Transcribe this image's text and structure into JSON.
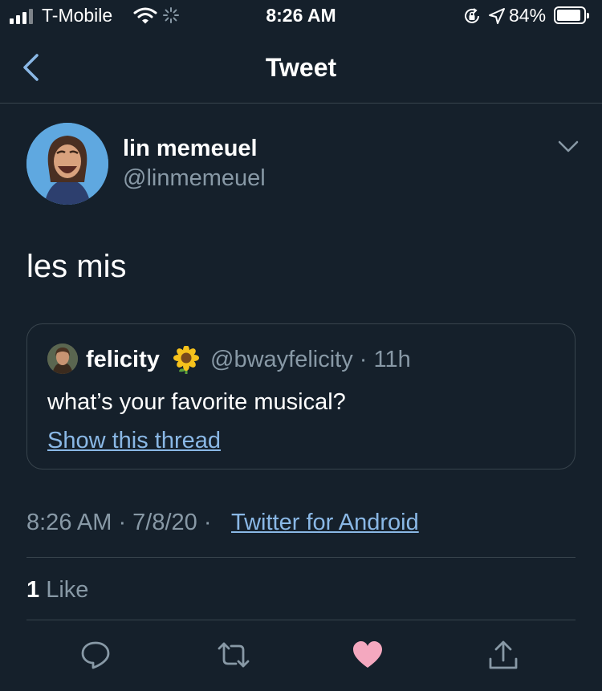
{
  "status_bar": {
    "carrier": "T-Mobile",
    "time": "8:26 AM",
    "battery": "84%",
    "battery_level": 0.84,
    "icons": [
      "signal-icon",
      "wifi-icon",
      "loading-icon",
      "orientation-lock-icon",
      "location-icon",
      "battery-icon"
    ]
  },
  "nav": {
    "title": "Tweet",
    "back_icon": "chevron-left-icon"
  },
  "tweet": {
    "author_name": "lin memeuel",
    "author_handle": "@linmemeuel",
    "text": "les mis",
    "timestamp": "8:26 AM · 7/8/20 · ",
    "source": "Twitter for Android",
    "like_count": "1",
    "like_label": " Like"
  },
  "quoted": {
    "name": "felicity",
    "emoji": "sunflower-icon",
    "handle": "@bwayfelicity · 11h",
    "text": "what’s your favorite musical?",
    "show_thread": "Show this thread"
  },
  "actions": [
    "reply-icon",
    "retweet-icon",
    "like-icon",
    "share-icon"
  ],
  "colors": {
    "background": "#15202b",
    "link": "#8ab8e6",
    "secondary_text": "#8899a6",
    "liked_heart": "#f4a8bf",
    "divider": "#38444d"
  }
}
